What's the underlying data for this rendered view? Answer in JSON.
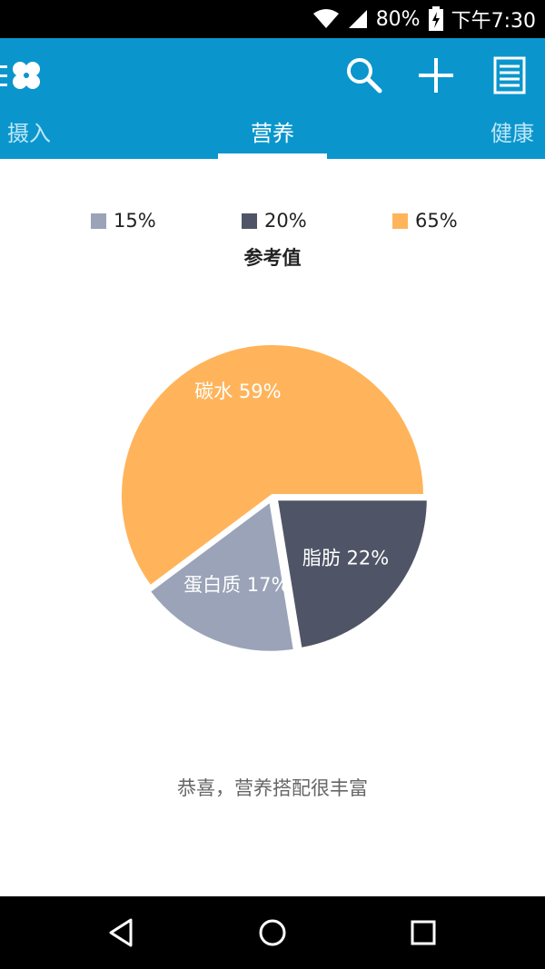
{
  "status_bar": {
    "battery": "80%",
    "time": "下午7:30"
  },
  "app_bar": {
    "logo_icon": "clover-menu-icon",
    "actions": [
      "search-icon",
      "add-icon",
      "list-icon"
    ],
    "tabs": [
      {
        "label": "摄入",
        "active": false
      },
      {
        "label": "营养",
        "active": true
      },
      {
        "label": "健康",
        "active": false
      }
    ]
  },
  "reference": {
    "legend": [
      {
        "label": "15%",
        "color": "#9aa3b8"
      },
      {
        "label": "20%",
        "color": "#4f5566"
      },
      {
        "label": "65%",
        "color": "#ffb45b"
      }
    ],
    "title": "参考值"
  },
  "chart_data": {
    "type": "pie",
    "slices": [
      {
        "name": "碳水",
        "value": 59,
        "label": "碳水 59%",
        "color": "#ffb45b"
      },
      {
        "name": "脂肪",
        "value": 22,
        "label": "脂肪 22%",
        "color": "#4f5566"
      },
      {
        "name": "蛋白质",
        "value": 17,
        "label": "蛋白质 17%",
        "color": "#9aa3b8"
      }
    ]
  },
  "summary": "恭喜，营养搭配很丰富",
  "nav_bar": [
    "back-icon",
    "home-icon",
    "recents-icon"
  ]
}
